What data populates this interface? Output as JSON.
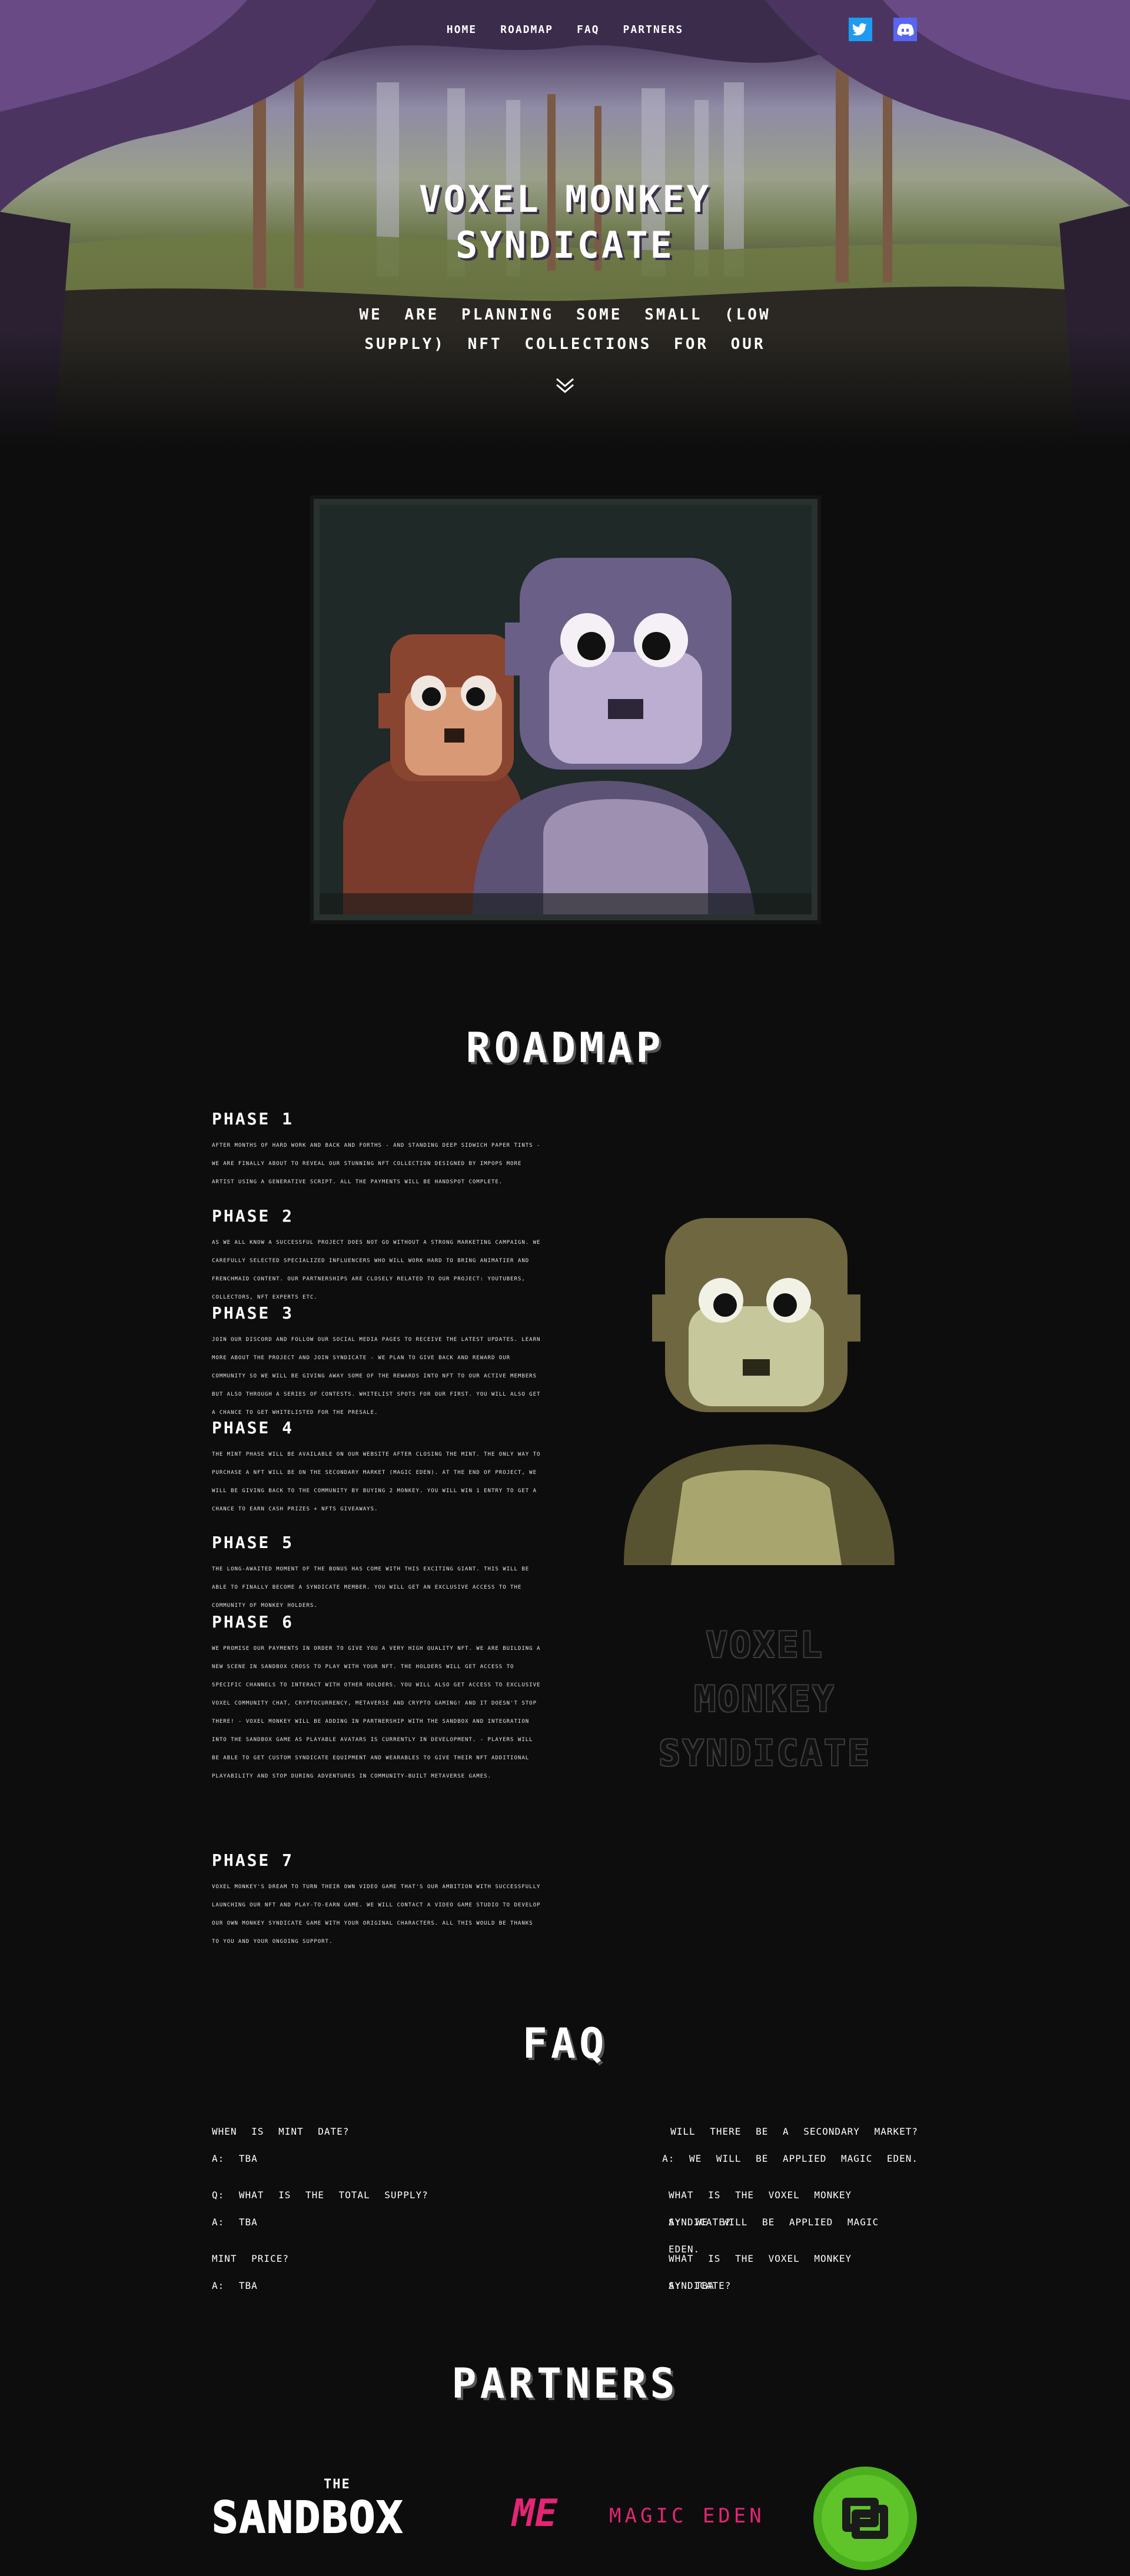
{
  "nav": {
    "links": [
      "HOME",
      "ROADMAP",
      "FAQ",
      "PARTNERS"
    ],
    "social": [
      "twitter-icon",
      "discord-icon"
    ]
  },
  "hero": {
    "title_line1": "VOXEL MONKEY",
    "title_line2": "SYNDICATE",
    "subtitle": "WE ARE PLANNING SOME SMALL (LOW SUPPLY) NFT COLLECTIONS FOR OUR"
  },
  "roadmap": {
    "heading": "ROADMAP",
    "phases": [
      {
        "title": "PHASE 1",
        "text": "After months of hard work and back and forths - and standing deep sidwich paper tints - we are finally about to reveal our stunning NFT collection designed by Impops more artist using a generative script. all the payments will be handspot complete."
      },
      {
        "title": "PHASE 2",
        "text": "As we all know a successful project does not go without a strong marketing campaign. we carefully selected specialized influencers who will work hard to bring Animatier and frenchmaid content. our partnerships are closely related to our project: youtubers, collectors, NFT experts etc."
      },
      {
        "title": "PHASE 3",
        "text": "Join our discord and follow our social media pages to receive the latest updates. learn more about the project and join syndicate - we plan to give back and reward our community so we will be giving away some of the rewards into NFT to our active members but also through a series of contests. whitelist spots for our first. you will also get a chance to get whitelisted for the presale."
      },
      {
        "title": "PHASE 4",
        "text": "The mint phase will be available on our website after closing the mint. the only way to purchase a NFT will be on the secondary market (magic eden). at the end of project, we will be giving back to the community by buying 2 monkey. you will win 1 entry to get a chance to earn cash prizes + NFTs giveaways."
      },
      {
        "title": "PHASE 5",
        "text": "The long-awaited moment of the bonus has come with this exciting giant. this will be able to finally become a syndicate member. you will get an exclusive access to the community of monkey holders."
      },
      {
        "title": "PHASE 6",
        "text": "We promise our payments in order to give you a very high quality NFT. we are building a new scene in Sandbox cross to play with your NFT. the holders will get access to specific channels to interact with other holders. you will also get access to exclusive voxel community chat, cryptocurrency, metaverse and crypto gaming! And it doesn't stop there! - Voxel monkey will be adding in partnership with the sandbox and integration into the sandbox game as playable avatars is currently in development. - Players will be able to get custom syndicate equipment and wearables to give their NFT additional playability and stop during adventures in community-built metaverse games."
      },
      {
        "title": "PHASE 7",
        "text": "Voxel monkey's dream to turn their own video game that's our ambition with successfully launching our NFT and play-to-earn game. we will contact a video game studio to develop our own monkey syndicate game with your original characters. all this would be thanks to you and your ongoing support."
      }
    ],
    "ghost_lines": [
      "VOXEL",
      "MONKEY",
      "SYNDICATE"
    ]
  },
  "faq": {
    "heading": "FAQ",
    "left": [
      {
        "q": "WHEN IS MINT DATE?",
        "a": "A: TBA"
      },
      {
        "q": "Q: WHAT IS THE TOTAL SUPPLY?",
        "a": "A: TBA"
      },
      {
        "q": "MINT PRICE?",
        "a": "A: TBA"
      }
    ],
    "right": [
      {
        "q": "WILL THERE BE A SECONDARY MARKET?",
        "a": "A: WE WILL BE APPLIED MAGIC EDEN."
      },
      {
        "q": "WHAT IS THE VOXEL MONKEY SYNDICATE?",
        "a": "A: WE WILL BE APPLIED MAGIC EDEN."
      },
      {
        "q": "WHAT IS THE VOXEL MONKEY SYNDICATE?",
        "a": "A: TBA"
      }
    ]
  },
  "partners": {
    "heading": "PARTNERS",
    "sandbox_the": "THE",
    "sandbox_name": "SANDBOX",
    "magiceden_mark": "ME",
    "magiceden_name": "MAGIC EDEN",
    "colors": {
      "magic_eden": "#e42575",
      "green": "#4caf1e"
    }
  }
}
